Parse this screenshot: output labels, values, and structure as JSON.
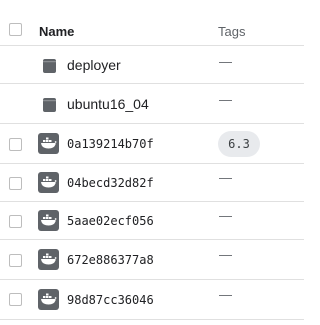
{
  "header": {
    "name_label": "Name",
    "tags_label": "Tags"
  },
  "rows": [
    {
      "type": "folder",
      "name": "deployer",
      "tag": "—"
    },
    {
      "type": "folder",
      "name": "ubuntu16_04",
      "tag": "—"
    },
    {
      "type": "image",
      "name": "0a139214b70f",
      "tag": "6.3"
    },
    {
      "type": "image",
      "name": "04becd32d82f",
      "tag": "—"
    },
    {
      "type": "image",
      "name": "5aae02ecf056",
      "tag": "—"
    },
    {
      "type": "image",
      "name": "672e886377a8",
      "tag": "—"
    },
    {
      "type": "image",
      "name": "98d87cc36046",
      "tag": "—"
    }
  ],
  "icons": {
    "folder": "folder-icon",
    "image": "docker-image-icon"
  },
  "colors": {
    "icon_gray": "#5f6368",
    "divider": "#e0e0e0",
    "chip_bg": "#e8eaed"
  }
}
